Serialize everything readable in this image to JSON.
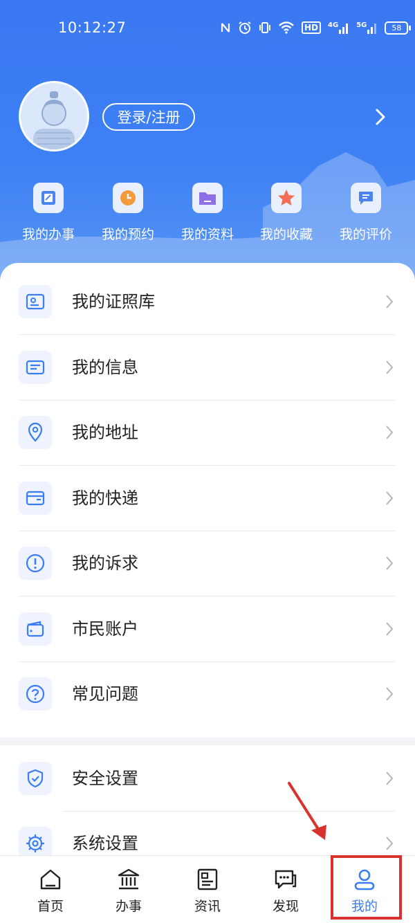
{
  "status_bar": {
    "time": "10:12:27",
    "hd": "HD",
    "net4g": "4G",
    "net5g": "5G",
    "battery": "58"
  },
  "profile": {
    "login_label": "登录/注册"
  },
  "quick_actions": [
    {
      "label": "我的办事",
      "icon": "edit-icon"
    },
    {
      "label": "我的预约",
      "icon": "clock-icon"
    },
    {
      "label": "我的资料",
      "icon": "folder-icon"
    },
    {
      "label": "我的收藏",
      "icon": "star-icon"
    },
    {
      "label": "我的评价",
      "icon": "comment-icon"
    }
  ],
  "menu_group_1": [
    {
      "label": "我的证照库",
      "icon": "id-card-icon"
    },
    {
      "label": "我的信息",
      "icon": "info-card-icon"
    },
    {
      "label": "我的地址",
      "icon": "location-pin-icon"
    },
    {
      "label": "我的快递",
      "icon": "package-icon"
    },
    {
      "label": "我的诉求",
      "icon": "alert-icon"
    },
    {
      "label": "市民账户",
      "icon": "wallet-icon"
    },
    {
      "label": "常见问题",
      "icon": "question-icon"
    }
  ],
  "menu_group_2": [
    {
      "label": "安全设置",
      "icon": "shield-icon"
    },
    {
      "label": "系统设置",
      "icon": "gear-icon"
    }
  ],
  "bottom_nav": [
    {
      "label": "首页",
      "icon": "home-icon"
    },
    {
      "label": "办事",
      "icon": "government-icon"
    },
    {
      "label": "资讯",
      "icon": "news-icon"
    },
    {
      "label": "发现",
      "icon": "chat-icon"
    },
    {
      "label": "我的",
      "icon": "user-icon",
      "active": true
    }
  ],
  "colors": {
    "primary": "#3a7cf3",
    "highlight": "#d8322e"
  }
}
